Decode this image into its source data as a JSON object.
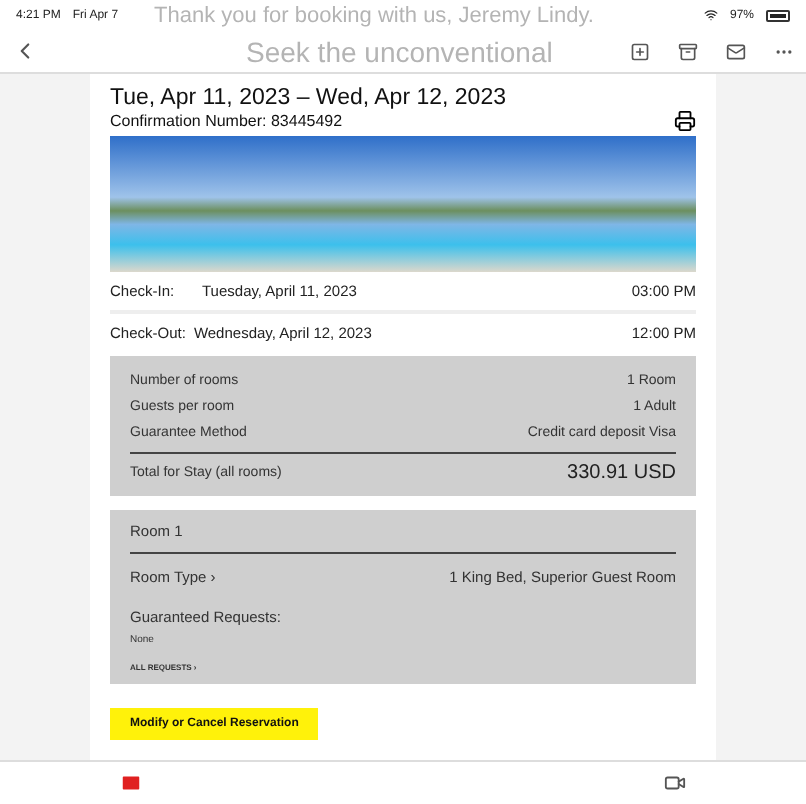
{
  "status_bar": {
    "time": "4:21 PM",
    "date": "Fri Apr 7",
    "battery": "97%"
  },
  "backdrop": {
    "heading": "Thank you for booking with us, Jeremy Lindy.",
    "tagline": "Seek the unconventional"
  },
  "reservation": {
    "dates": "Tue, Apr 11, 2023 – Wed, Apr 12, 2023",
    "confirmation": "Confirmation Number: 83445492",
    "stay": [
      {
        "label": "Check-In:",
        "date": "Tuesday, April 11, 2023",
        "time": "03:00 PM"
      },
      {
        "label": "Check-Out:",
        "date": "Wednesday, April 12, 2023",
        "time": "12:00 PM"
      }
    ],
    "summary": [
      {
        "label": "Number of rooms",
        "value": "1 Room"
      },
      {
        "label": "Guests per room",
        "value": "1 Adult"
      },
      {
        "label": "Guarantee Method",
        "value": "Credit card deposit Visa"
      }
    ],
    "total": {
      "label": "Total for Stay (all rooms)",
      "value": "330.91 USD"
    },
    "room": {
      "title": "Room 1",
      "type_label": "Room Type ›",
      "type_value": "1 King Bed, Superior Guest Room",
      "requests_label": "Guaranteed Requests:",
      "requests_value": "None",
      "all_requests": "ALL REQUESTS ›"
    },
    "action": "Modify or Cancel Reservation"
  }
}
